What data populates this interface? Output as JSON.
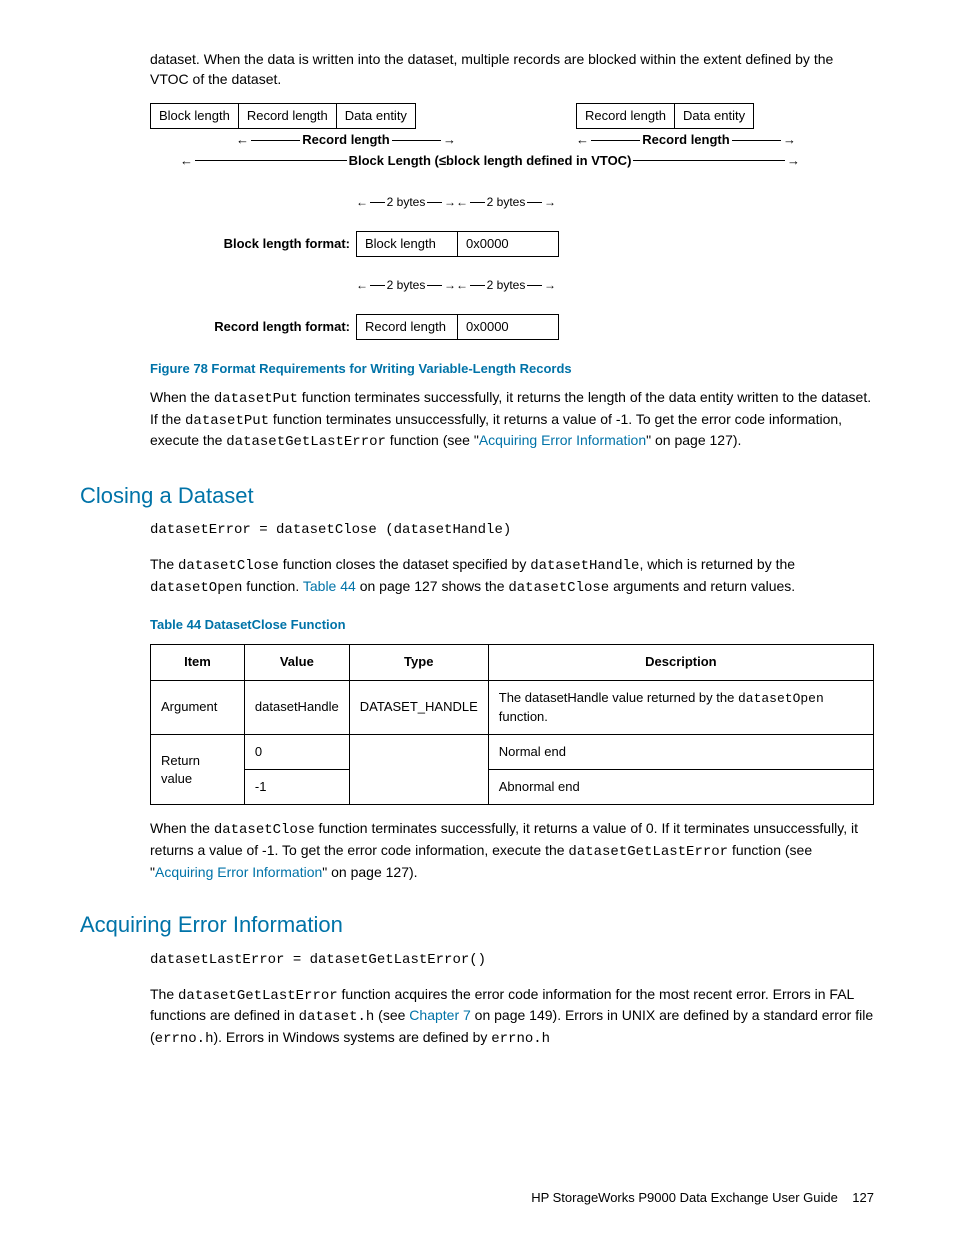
{
  "intro": {
    "p1": "dataset. When the data is written into the dataset, multiple records are blocked within the extent defined by the VTOC of the dataset."
  },
  "diagram": {
    "row1a": [
      "Block length",
      "Record length",
      "Data entity"
    ],
    "row1b": [
      "Record length",
      "Data entity"
    ],
    "record_length": "Record length",
    "block_line": "Block Length (≤block length defined in VTOC)",
    "two_bytes": "2 bytes",
    "block_format_label": "Block length format:",
    "block_format_cells": [
      "Block length",
      "0x0000"
    ],
    "record_format_label": "Record length format:",
    "record_format_cells": [
      "Record length",
      "0x0000"
    ]
  },
  "fig_caption": "Figure 78 Format Requirements for Writing Variable-Length Records",
  "para_after_fig": {
    "t1": "When the ",
    "c1": "datasetPut",
    "t2": " function terminates successfully, it returns the length of the data entity written to the dataset. If the ",
    "c2": "datasetPut",
    "t3": " function terminates unsuccessfully, it returns a value of -1. To get the error code information, execute the ",
    "c3": "datasetGetLastError",
    "t4": " function (see \"",
    "link": "Acquiring Error Information",
    "t5": "\" on page 127)."
  },
  "closing": {
    "heading": "Closing a Dataset",
    "code": "datasetError = datasetClose (datasetHandle)",
    "p_t1": "The ",
    "p_c1": "datasetClose",
    "p_t2": " function closes the dataset specified by ",
    "p_c2": "datasetHandle",
    "p_t3": ", which is returned by the ",
    "p_c3": "datasetOpen",
    "p_t4": " function. ",
    "p_link": "Table 44",
    "p_t5": " on page 127 shows the ",
    "p_c4": "datasetClose",
    "p_t6": " arguments and return values."
  },
  "table_caption": "Table 44 DatasetClose Function",
  "table": {
    "headers": [
      "Item",
      "Value",
      "Type",
      "Description"
    ],
    "rows": [
      {
        "item": "Argument",
        "value": "datasetHandle",
        "type": "DATASET_HANDLE",
        "desc_t1": "The datasetHandle value returned by the ",
        "desc_c": "datasetOpen",
        "desc_t2": " function."
      },
      {
        "item": "Return value",
        "value": "0",
        "type": "",
        "desc": "Normal end"
      },
      {
        "value": "-1",
        "type": "",
        "desc": "Abnormal end"
      }
    ]
  },
  "closing_after": {
    "t1": "When the ",
    "c1": "datasetClose",
    "t2": " function terminates successfully, it returns a value of 0. If it terminates unsuccessfully, it returns a value of -1. To get the error code information, execute the ",
    "c2": "datasetGetLastError",
    "t3": " function (see \"",
    "link": "Acquiring Error Information",
    "t4": "\" on page 127)."
  },
  "acquiring": {
    "heading": "Acquiring Error Information",
    "code": "datasetLastError = datasetGetLastError()",
    "t1": "The ",
    "c1": "datasetGetLastError",
    "t2": " function acquires the error code information for the most recent error. Errors in FAL functions are defined in ",
    "c2": "dataset.h",
    "t3": " (see ",
    "link": "Chapter 7",
    "t4": " on page 149). Errors in UNIX are defined by a standard error file (",
    "c3": "errno.h",
    "t5": "). Errors in Windows systems are defined by ",
    "c4": "errno.h"
  },
  "footer": {
    "title": "HP StorageWorks P9000 Data Exchange User Guide",
    "page": "127"
  }
}
